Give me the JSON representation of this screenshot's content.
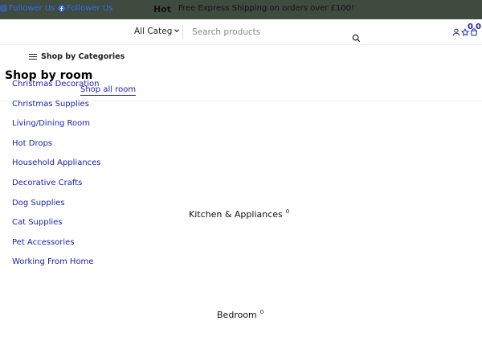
{
  "topbar": {
    "follow_1": "Follower Us",
    "follow_2": "Follower Us",
    "hot_label": "Hot",
    "promo_text": "Free Express Shipping on orders over £100!",
    "bg_color": "#3f4b3f",
    "link_color": "#2f6ef2"
  },
  "header": {
    "category_select": "All Categ",
    "search_placeholder": "Search products",
    "wishlist_count": "0",
    "cart_count": "0",
    "accent_color": "#1a22a8",
    "icons": [
      "user-icon",
      "star-icon",
      "cart-icon",
      "search-icon",
      "chevron-down-icon"
    ]
  },
  "nav": {
    "shop_by_categories": "Shop by Categories"
  },
  "room": {
    "title": "Shop by room",
    "shop_all": "Shop all room"
  },
  "menu": {
    "items": [
      "Christmas Decoration",
      "Christmas Supplies",
      "Living/Dining Room",
      "Hot Drops",
      "Household Appliances",
      "Decorative Crafts",
      "Dog Supplies",
      "Cat Supplies",
      "Pet Accessories",
      "Working From Home"
    ]
  },
  "sections": [
    {
      "name": "Kitchen & Appliances",
      "count": "0"
    },
    {
      "name": "Bedroom",
      "count": "0"
    }
  ]
}
